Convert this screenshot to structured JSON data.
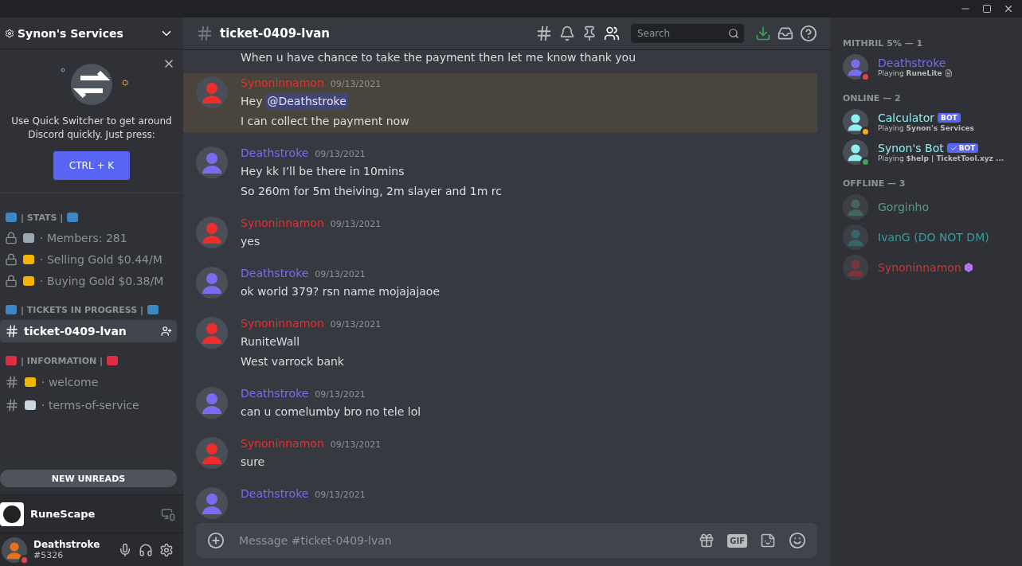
{
  "server": {
    "name": "Synon's Services"
  },
  "quick_switcher": {
    "text": "Use Quick Switcher to get around Discord quickly. Just press:",
    "shortcut": "CTRL + K"
  },
  "categories": [
    {
      "name": "| STATS |",
      "channels": [
        {
          "name": "· Members: 281",
          "locked": true,
          "selected": false
        },
        {
          "name": "· Selling Gold $0.44/M",
          "locked": true,
          "selected": false
        },
        {
          "name": "· Buying Gold $0.38/M",
          "locked": true,
          "selected": false
        }
      ]
    },
    {
      "name": "| TICKETS IN PROGRESS |",
      "channels": [
        {
          "name": "ticket-0409-lvan",
          "locked": false,
          "selected": true
        }
      ]
    },
    {
      "name": "| INFORMATION |",
      "channels": [
        {
          "name": "· welcome",
          "locked": false,
          "selected": false
        },
        {
          "name": "· terms-of-service",
          "locked": false,
          "selected": false
        }
      ]
    }
  ],
  "new_unreads": "NEW UNREADS",
  "activity": {
    "name": "RuneScape"
  },
  "user": {
    "name": "Deathstroke",
    "tag": "#5326"
  },
  "channel": {
    "name": "ticket-0409-lvan"
  },
  "search": {
    "placeholder": "Search"
  },
  "messages": [
    {
      "continuation": true,
      "highlighted": false,
      "lines": [
        [
          {
            "text": "When u have chance to take the payment then let me know thank you"
          }
        ]
      ]
    },
    {
      "author": "Synoninnamon",
      "color": "#ed2c2c",
      "timestamp": "09/13/2021",
      "highlighted": true,
      "lines": [
        [
          {
            "text": "Hey"
          },
          {
            "text": "@Deathstroke",
            "mention": true
          }
        ],
        [
          {
            "text": "I can collect the payment now"
          }
        ]
      ]
    },
    {
      "author": "Deathstroke",
      "color": "#7a6cf0",
      "timestamp": "09/13/2021",
      "highlighted": false,
      "lines": [
        [
          {
            "text": "Hey kk I’ll be there in 10mins"
          }
        ],
        [
          {
            "text": "So 260m for 5m theiving, 2m slayer and 1m rc"
          }
        ]
      ]
    },
    {
      "author": "Synoninnamon",
      "color": "#ed2c2c",
      "timestamp": "09/13/2021",
      "highlighted": false,
      "lines": [
        [
          {
            "text": "yes"
          }
        ]
      ]
    },
    {
      "author": "Deathstroke",
      "color": "#7a6cf0",
      "timestamp": "09/13/2021",
      "highlighted": false,
      "lines": [
        [
          {
            "text": "ok world 379? rsn name mojajajaoe"
          }
        ]
      ]
    },
    {
      "author": "Synoninnamon",
      "color": "#ed2c2c",
      "timestamp": "09/13/2021",
      "highlighted": false,
      "lines": [
        [
          {
            "text": "RuniteWall"
          }
        ],
        [
          {
            "text": "West varrock bank"
          }
        ]
      ]
    },
    {
      "author": "Deathstroke",
      "color": "#7a6cf0",
      "timestamp": "09/13/2021",
      "highlighted": false,
      "lines": [
        [
          {
            "text": "can u comelumby bro no tele lol"
          }
        ]
      ]
    },
    {
      "author": "Synoninnamon",
      "color": "#ed2c2c",
      "timestamp": "09/13/2021",
      "highlighted": false,
      "lines": [
        [
          {
            "text": "sure"
          }
        ]
      ]
    },
    {
      "author": "Deathstroke",
      "color": "#7a6cf0",
      "timestamp": "09/13/2021",
      "highlighted": false
    }
  ],
  "composer": {
    "placeholder": "Message #ticket-0409-lvan",
    "gif_label": "GIF"
  },
  "member_groups": [
    {
      "title": "MITHRIL 5% — 1",
      "members": [
        {
          "name": "Deathstroke",
          "color": "#7a6cf0",
          "offline": false,
          "status": {
            "color": "#ed4245"
          },
          "activity": "Playing",
          "game": "RuneLite"
        }
      ]
    },
    {
      "title": "ONLINE — 2",
      "members": [
        {
          "name": "Calculator",
          "color": "#8ff0f0",
          "offline": false,
          "status": {
            "color": "#faa81a"
          },
          "activity": "Playing",
          "game": "Synon's Services",
          "badge": "BOT",
          "verified": false
        },
        {
          "name": "Synon's Bot",
          "color": "#8ff0f0",
          "offline": false,
          "status": {
            "color": "#3ba55d"
          },
          "activity": "Playing",
          "game": "$help | TicketTool.xyz ...",
          "badge": "BOT",
          "verified": true
        }
      ]
    },
    {
      "title": "OFFLINE — 3",
      "members": [
        {
          "name": "Gorginho",
          "color": "#5a9a80",
          "offline": true
        },
        {
          "name": "IvanG (DO NOT DM)",
          "color": "#3a9c9c",
          "offline": true
        },
        {
          "name": "Synoninnamon",
          "color": "#c43a3a",
          "offline": true,
          "booster": true
        }
      ]
    }
  ]
}
